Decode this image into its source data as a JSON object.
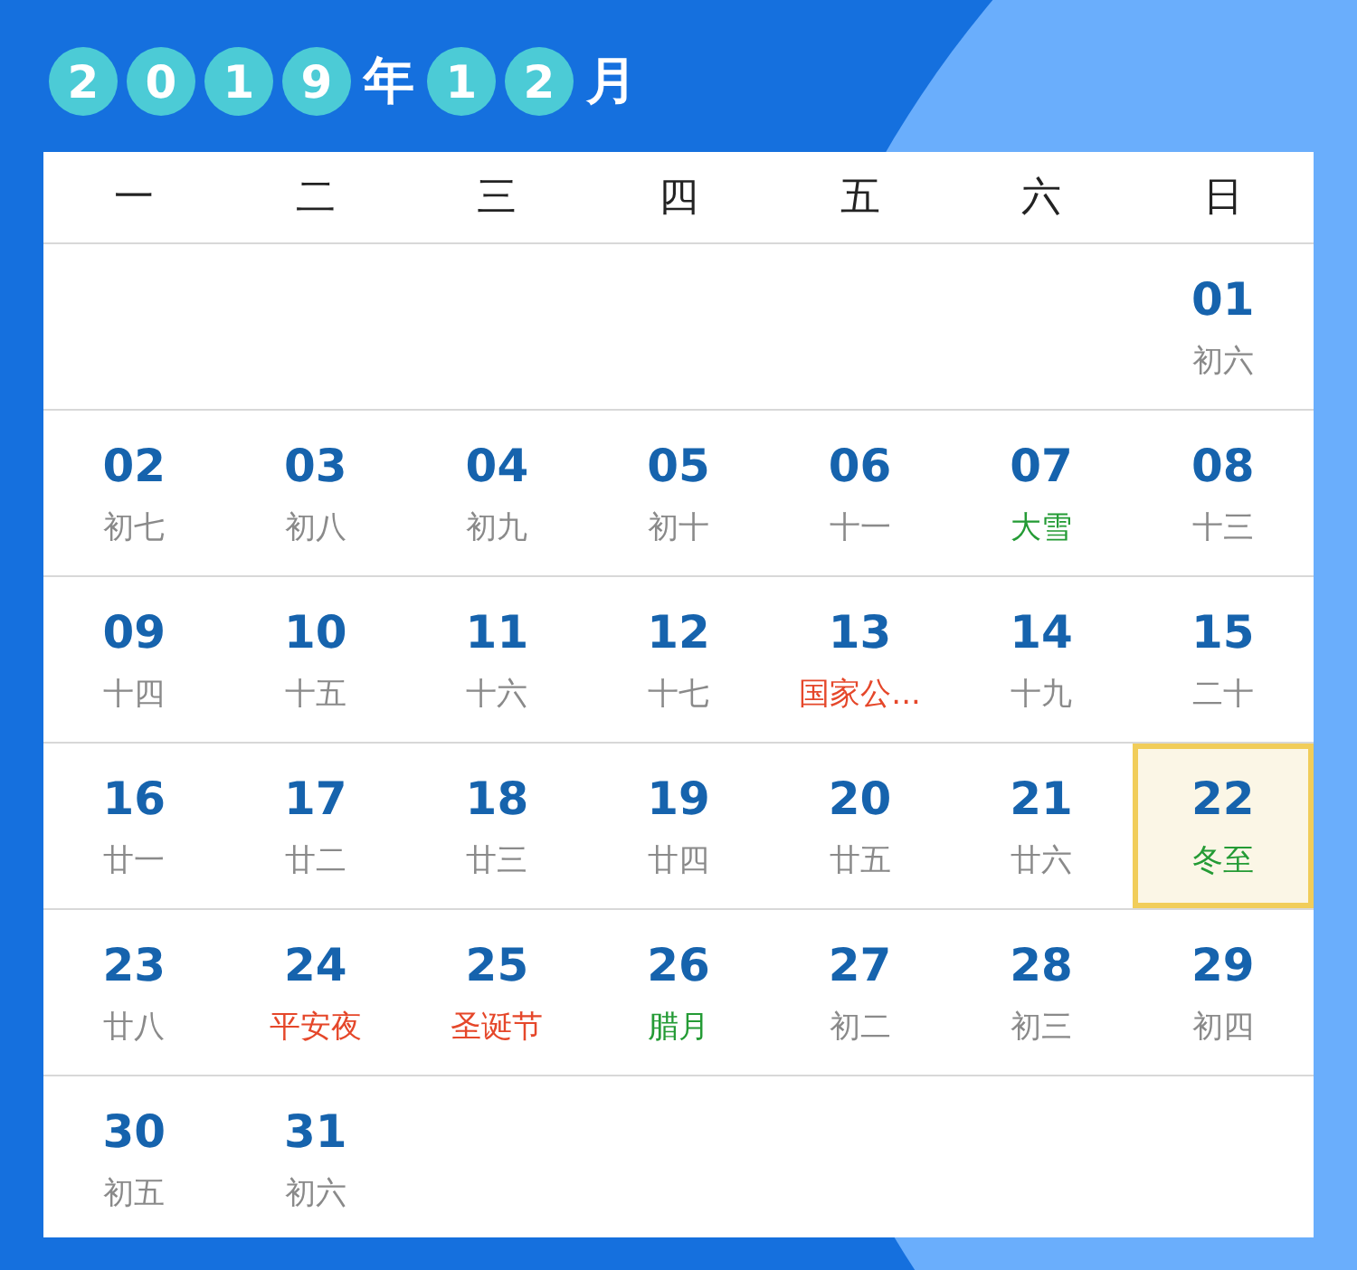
{
  "title": {
    "year_digits": [
      "2",
      "0",
      "1",
      "9"
    ],
    "year_unit": "年",
    "month_digits": [
      "1",
      "2"
    ],
    "month_unit": "月"
  },
  "weekdays": [
    "一",
    "二",
    "三",
    "四",
    "五",
    "六",
    "日"
  ],
  "weeks": [
    [
      {
        "kind": "blank"
      },
      {
        "kind": "blank"
      },
      {
        "kind": "blank"
      },
      {
        "kind": "blank"
      },
      {
        "kind": "blank"
      },
      {
        "kind": "blank"
      },
      {
        "kind": "day",
        "day": "01",
        "note": "初六",
        "color": "#8a8a8a",
        "selected": false
      }
    ],
    [
      {
        "kind": "day",
        "day": "02",
        "note": "初七",
        "color": "#8a8a8a",
        "selected": false
      },
      {
        "kind": "day",
        "day": "03",
        "note": "初八",
        "color": "#8a8a8a",
        "selected": false
      },
      {
        "kind": "day",
        "day": "04",
        "note": "初九",
        "color": "#8a8a8a",
        "selected": false
      },
      {
        "kind": "day",
        "day": "05",
        "note": "初十",
        "color": "#8a8a8a",
        "selected": false
      },
      {
        "kind": "day",
        "day": "06",
        "note": "十一",
        "color": "#8a8a8a",
        "selected": false
      },
      {
        "kind": "day",
        "day": "07",
        "note": "大雪",
        "color": "#249b35",
        "selected": false
      },
      {
        "kind": "day",
        "day": "08",
        "note": "十三",
        "color": "#8a8a8a",
        "selected": false
      }
    ],
    [
      {
        "kind": "day",
        "day": "09",
        "note": "十四",
        "color": "#8a8a8a",
        "selected": false
      },
      {
        "kind": "day",
        "day": "10",
        "note": "十五",
        "color": "#8a8a8a",
        "selected": false
      },
      {
        "kind": "day",
        "day": "11",
        "note": "十六",
        "color": "#8a8a8a",
        "selected": false
      },
      {
        "kind": "day",
        "day": "12",
        "note": "十七",
        "color": "#8a8a8a",
        "selected": false
      },
      {
        "kind": "day",
        "day": "13",
        "note": "国家公...",
        "color": "#e5472a",
        "selected": false
      },
      {
        "kind": "day",
        "day": "14",
        "note": "十九",
        "color": "#8a8a8a",
        "selected": false
      },
      {
        "kind": "day",
        "day": "15",
        "note": "二十",
        "color": "#8a8a8a",
        "selected": false
      }
    ],
    [
      {
        "kind": "day",
        "day": "16",
        "note": "廿一",
        "color": "#8a8a8a",
        "selected": false
      },
      {
        "kind": "day",
        "day": "17",
        "note": "廿二",
        "color": "#8a8a8a",
        "selected": false
      },
      {
        "kind": "day",
        "day": "18",
        "note": "廿三",
        "color": "#8a8a8a",
        "selected": false
      },
      {
        "kind": "day",
        "day": "19",
        "note": "廿四",
        "color": "#8a8a8a",
        "selected": false
      },
      {
        "kind": "day",
        "day": "20",
        "note": "廿五",
        "color": "#8a8a8a",
        "selected": false
      },
      {
        "kind": "day",
        "day": "21",
        "note": "廿六",
        "color": "#8a8a8a",
        "selected": false
      },
      {
        "kind": "day",
        "day": "22",
        "note": "冬至",
        "color": "#249b35",
        "selected": true
      }
    ],
    [
      {
        "kind": "day",
        "day": "23",
        "note": "廿八",
        "color": "#8a8a8a",
        "selected": false
      },
      {
        "kind": "day",
        "day": "24",
        "note": "平安夜",
        "color": "#e5472a",
        "selected": false
      },
      {
        "kind": "day",
        "day": "25",
        "note": "圣诞节",
        "color": "#e5472a",
        "selected": false
      },
      {
        "kind": "day",
        "day": "26",
        "note": "腊月",
        "color": "#249b35",
        "selected": false
      },
      {
        "kind": "day",
        "day": "27",
        "note": "初二",
        "color": "#8a8a8a",
        "selected": false
      },
      {
        "kind": "day",
        "day": "28",
        "note": "初三",
        "color": "#8a8a8a",
        "selected": false
      },
      {
        "kind": "day",
        "day": "29",
        "note": "初四",
        "color": "#8a8a8a",
        "selected": false
      }
    ],
    [
      {
        "kind": "day",
        "day": "30",
        "note": "初五",
        "color": "#8a8a8a",
        "selected": false
      },
      {
        "kind": "day",
        "day": "31",
        "note": "初六",
        "color": "#8a8a8a",
        "selected": false
      },
      {
        "kind": "blank"
      },
      {
        "kind": "blank"
      },
      {
        "kind": "blank"
      },
      {
        "kind": "blank"
      },
      {
        "kind": "blank"
      }
    ]
  ]
}
